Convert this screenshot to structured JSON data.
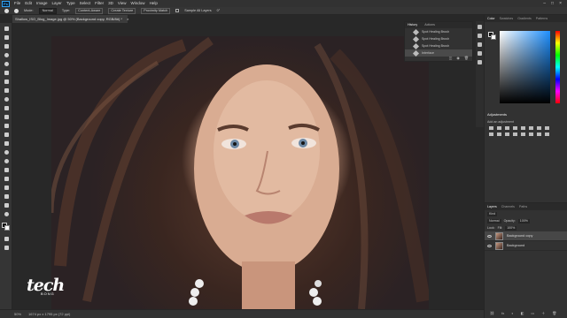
{
  "menubar": {
    "logo": "Ps",
    "items": [
      "File",
      "Edit",
      "Image",
      "Layer",
      "Type",
      "Select",
      "Filter",
      "3D",
      "View",
      "Window",
      "Help"
    ],
    "window_controls": [
      "–",
      "□",
      "×"
    ]
  },
  "options": {
    "mode_label": "Mode:",
    "mode_value": "Normal",
    "type_label": "Type:",
    "content_aware": "Content-Aware",
    "create_texture": "Create Texture",
    "proximity_match": "Proximity Match",
    "sample_all_layers": "Sample All Layers",
    "angle": "0°"
  },
  "document": {
    "tab_title": "Shallow_ISO_Blog_Image.jpg @ 50% (Background copy, RGB/8#) *",
    "tab_close": "×"
  },
  "history": {
    "tabs": [
      "History",
      "Actions"
    ],
    "items": [
      "Spot Healing Brush",
      "Spot Healing Brush",
      "Spot Healing Brush",
      "Interface"
    ],
    "footer_icons": [
      "◫",
      "◉",
      "🗑"
    ]
  },
  "color_panel": {
    "tabs": [
      "Color",
      "Swatches",
      "Gradients",
      "Patterns"
    ],
    "foreground": "#111111",
    "background": "#ffffff"
  },
  "adjustments": {
    "title": "Adjustments",
    "subtitle": "Add an adjustment"
  },
  "layers": {
    "tabs": [
      "Layers",
      "Channels",
      "Paths"
    ],
    "kind_label": "Kind",
    "blend_mode": "Normal",
    "opacity_label": "Opacity:",
    "opacity_value": "100%",
    "lock_label": "Lock:",
    "fill_label": "Fill:",
    "fill_value": "100%",
    "items": [
      {
        "name": "Background copy",
        "selected": true
      },
      {
        "name": "Background",
        "selected": false
      }
    ],
    "footer_icons": [
      "⛓",
      "fx",
      "◐",
      "◧",
      "▭",
      "＋",
      "🗑"
    ]
  },
  "status": {
    "zoom": "50%",
    "doc_info": "1674 px x 1795 px (72 ppi)"
  },
  "watermark": {
    "main": "tech",
    "sub": "BONG"
  },
  "toolbar": {
    "tools": [
      "move-icon",
      "artboard-icon",
      "marquee-icon",
      "lasso-icon",
      "quick-select-icon",
      "crop-icon",
      "frame-icon",
      "eyedropper-icon",
      "healing-brush-icon",
      "brush-icon",
      "clone-stamp-icon",
      "history-brush-icon",
      "eraser-icon",
      "gradient-icon",
      "blur-icon",
      "dodge-icon",
      "pen-icon",
      "type-icon",
      "path-select-icon",
      "rectangle-icon",
      "hand-icon",
      "zoom-icon",
      "more-tools-icon"
    ]
  }
}
